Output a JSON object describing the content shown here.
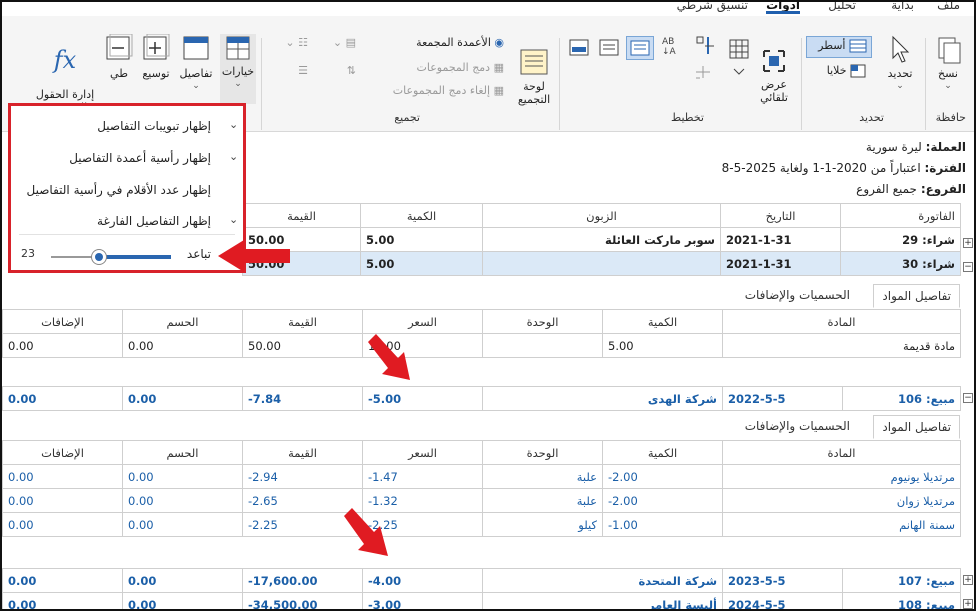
{
  "tabs": [
    "ملف",
    "بداية",
    "تحليل",
    "أدوات",
    "تنسيق شرطي"
  ],
  "ribbon": {
    "clipboard": {
      "copy": "نسخ",
      "group": "حافظة"
    },
    "select": {
      "select": "تحديد",
      "rows": "أسطر",
      "cells": "خلايا",
      "group": "تحديد"
    },
    "layout": {
      "auto_fit": "عرض\nتلقائي",
      "group": "تخطيط"
    },
    "grouping": {
      "group_board": "لوحة\nالتجميع",
      "grouped_columns": "الأعمدة المجمعة",
      "merge_groups": "دمج المجموعات",
      "unmerge_groups": "إلغاء دمج المجموعات",
      "group": "تجميع"
    },
    "details": {
      "options": "خيارات",
      "details": "تفاصيل",
      "expand": "توسيع",
      "collapse": "طي",
      "calc_fields": "إدارة الحقول\nالمحسوبة"
    }
  },
  "popup": {
    "items": [
      "إظهار تبويبات التفاصيل",
      "إظهار رأسية أعمدة التفاصيل",
      "إظهار عدد الأقلام في رأسية التفاصيل",
      "إظهار التفاصيل الفارغة"
    ],
    "spacing_label": "تباعد",
    "spacing_value": "23",
    "spacing_fraction": 0.6
  },
  "report_info": {
    "currency_label": "العملة:",
    "currency_value": "ليرة سورية",
    "period_label": "الفترة:",
    "period_value": "اعتباراً من 2020-1-1 ولغاية 2025-5-8",
    "branches_label": "الفروع:",
    "branches_value": "جميع الفروع"
  },
  "main_table": {
    "headers": [
      "الفاتورة",
      "التاريخ",
      "الزبون",
      "الكمية",
      "القيمة"
    ],
    "rows": [
      [
        "شراء: 29",
        "2021-1-31",
        "سوبر ماركت العائلة",
        "5.00",
        "50.00"
      ],
      [
        "شراء: 30",
        "2021-1-31",
        "",
        "5.00",
        "50.00"
      ]
    ]
  },
  "detail_tabs": {
    "items": "تفاصيل المواد",
    "discounts": "الحسميات والإضافات"
  },
  "detail_headers": [
    "المادة",
    "الكمية",
    "الوحدة",
    "السعر",
    "القيمة",
    "الحسم",
    "الإضافات"
  ],
  "detail1": [
    [
      "مادة قديمة",
      "5.00",
      "",
      "10.00",
      "50.00",
      "0.00",
      "0.00"
    ]
  ],
  "sale106": [
    "مبيع: 106",
    "2022-5-5",
    "شركة الهدى",
    "-5.00",
    "-7.84",
    "0.00",
    "0.00"
  ],
  "detail2": [
    [
      "مرتديلا يونيوم",
      "-2.00",
      "علبة",
      "-1.47",
      "-2.94",
      "0.00",
      "0.00"
    ],
    [
      "مرتديلا زوان",
      "-2.00",
      "علبة",
      "-1.32",
      "-2.65",
      "0.00",
      "0.00"
    ],
    [
      "سمنة الهانم",
      "-1.00",
      "كيلو",
      "-2.25",
      "-2.25",
      "0.00",
      "0.00"
    ]
  ],
  "sale107": [
    "مبيع: 107",
    "2023-5-5",
    "شركة المتحدة",
    "-4.00",
    "-17,600.00",
    "0.00",
    "0.00"
  ],
  "sale108": [
    "مبيع: 108",
    "2024-5-5",
    "ألبسة العامر",
    "-3.00",
    "-34,500.00",
    "0.00",
    "0.00"
  ],
  "colors": {
    "accent": "#1f5fae",
    "highlight": "#d8222a",
    "selected_row": "#dbe9f7",
    "link_text": "#1b5fa8"
  }
}
